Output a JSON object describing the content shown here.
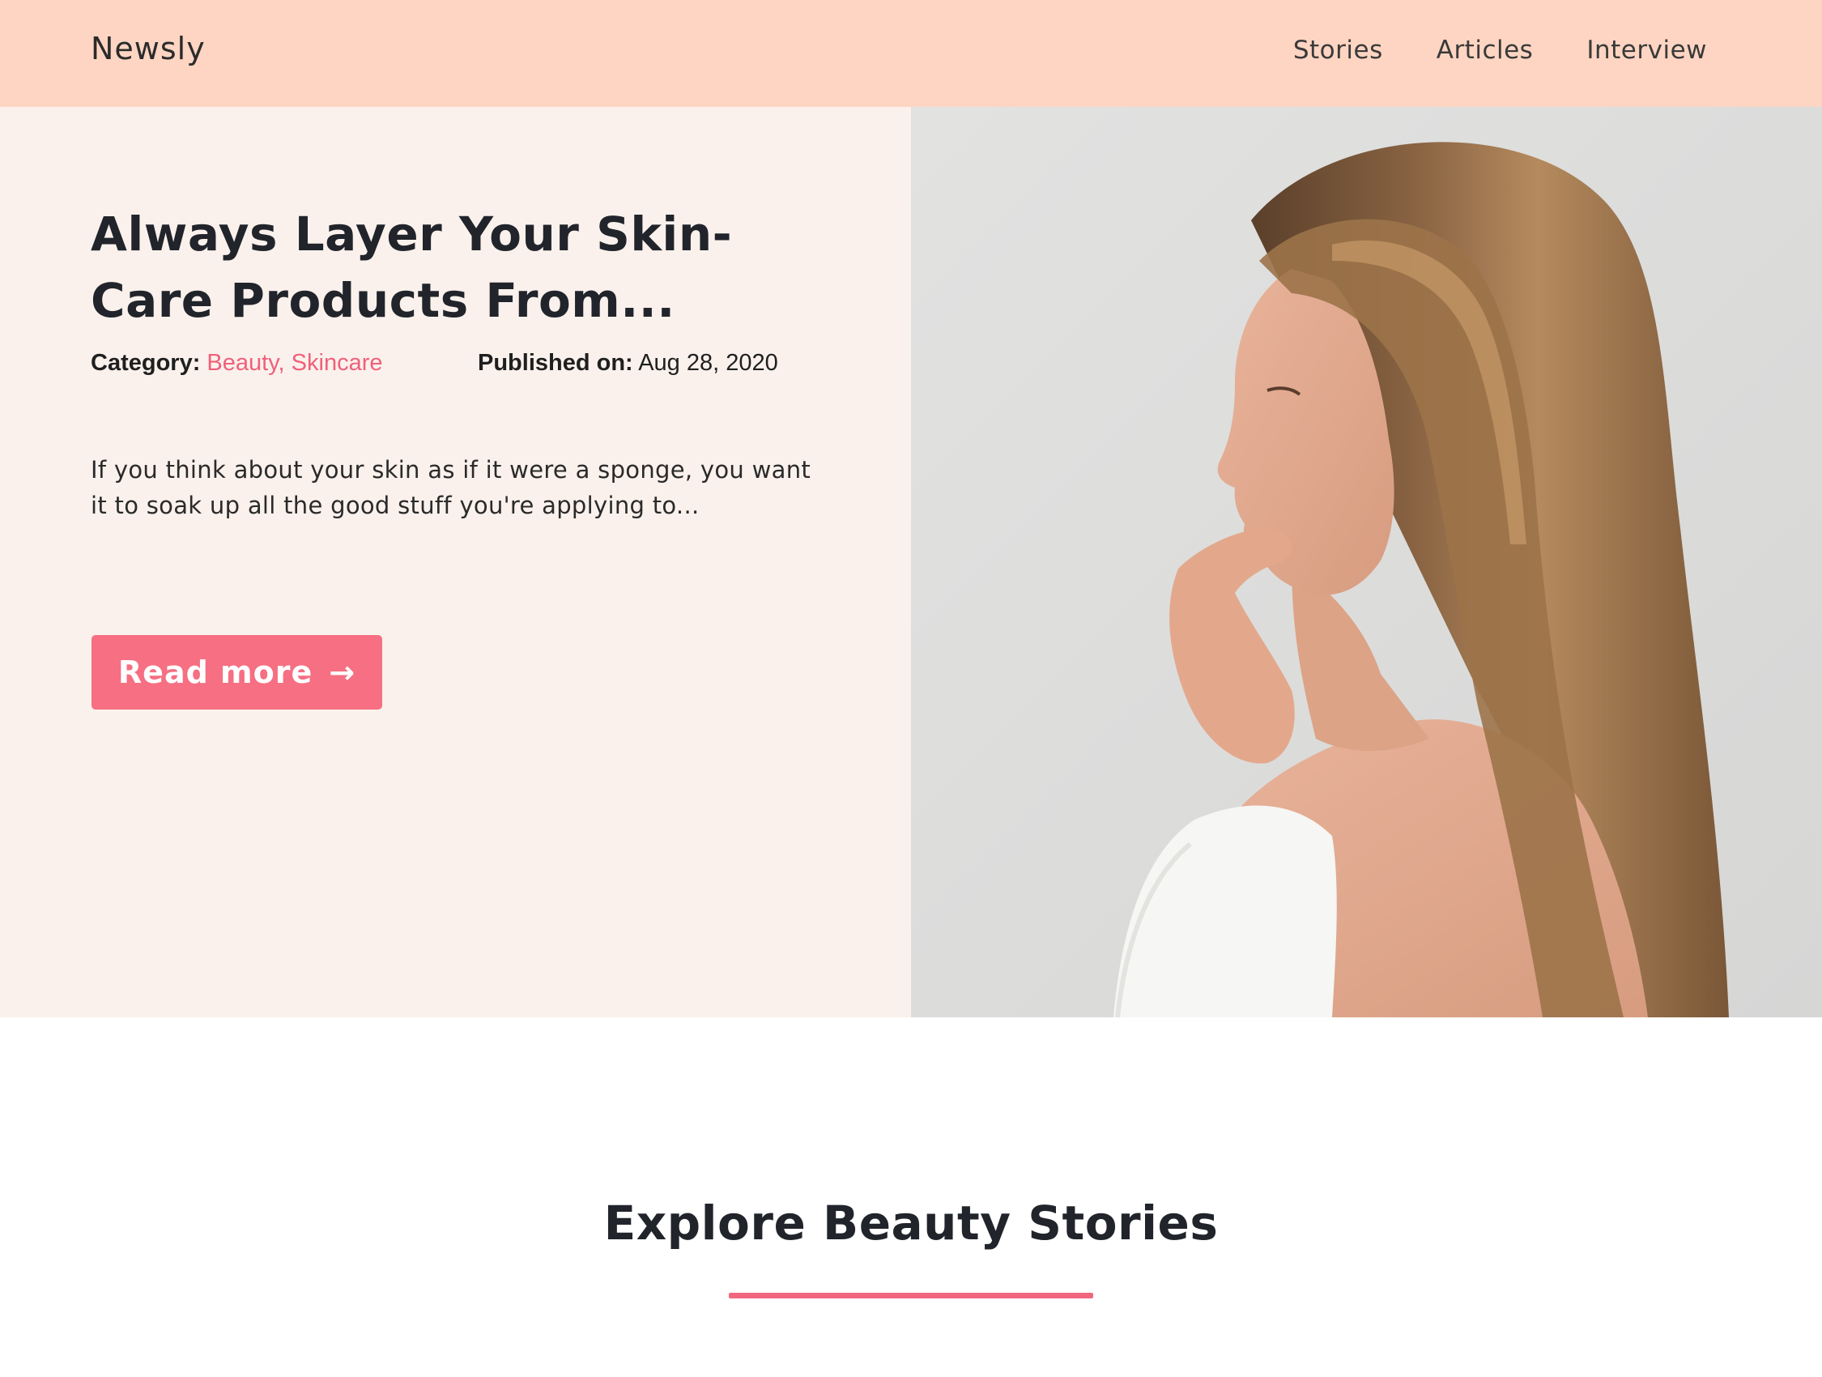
{
  "header": {
    "brand": "Newsly",
    "nav": [
      "Stories",
      "Articles",
      "Interview"
    ]
  },
  "hero": {
    "title": "Always Layer Your Skin-Care Products From...",
    "category_label": "Category:",
    "categories": "Beauty, Skincare",
    "published_label": "Published on:",
    "published_date": "Aug 28, 2020",
    "excerpt": "If you think about your skin as if it were a sponge, you want it to soak up all the good stuff you're applying to...",
    "read_more_label": "Read more",
    "read_more_icon": "arrow-right-icon",
    "image_alt": "Woman with long hair in profile wearing a white towel"
  },
  "section": {
    "title": "Explore Beauty Stories"
  },
  "colors": {
    "header_bg": "#fed5c2",
    "hero_left_bg": "#faf1ec",
    "accent": "#f66f82",
    "category_text": "#f0607a",
    "text_dark": "#21242a"
  }
}
